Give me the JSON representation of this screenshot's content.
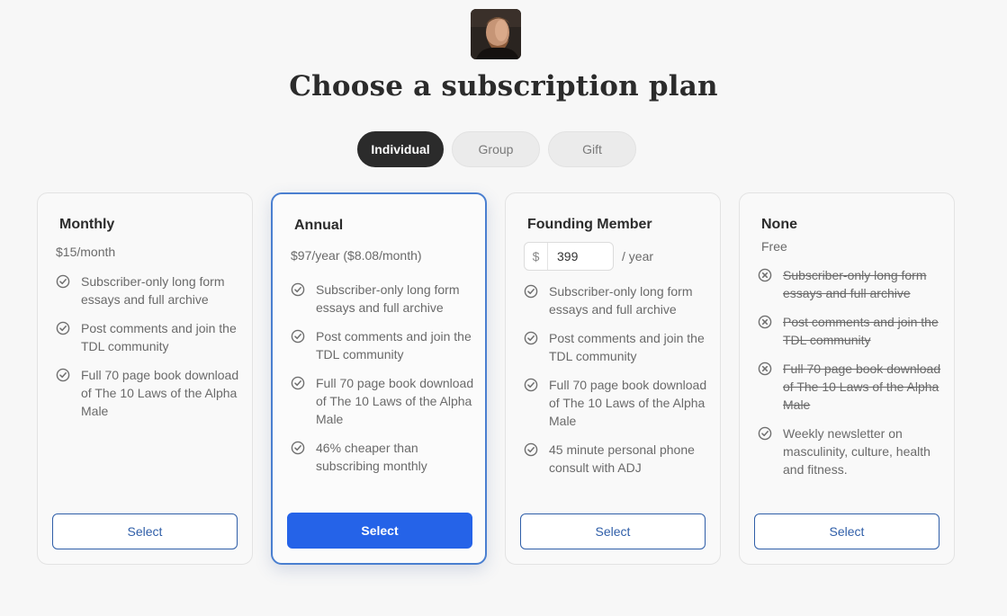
{
  "title": "Choose a subscription plan",
  "tabs": [
    {
      "label": "Individual"
    },
    {
      "label": "Group"
    },
    {
      "label": "Gift"
    }
  ],
  "plans": [
    {
      "name": "Monthly",
      "price": "$15/month",
      "features": [
        {
          "text": "Subscriber-only long form essays and full archive",
          "included": true
        },
        {
          "text": "Post comments and join the TDL community",
          "included": true
        },
        {
          "text": "Full 70 page book download of The 10 Laws of the Alpha Male",
          "included": true
        }
      ],
      "select_label": "Select"
    },
    {
      "name": "Annual",
      "price": "$97/year ($8.08/month)",
      "features": [
        {
          "text": "Subscriber-only long form essays and full archive",
          "included": true
        },
        {
          "text": "Post comments and join the TDL community",
          "included": true
        },
        {
          "text": "Full 70 page book download of The 10 Laws of the Alpha Male",
          "included": true
        },
        {
          "text": "46% cheaper than subscribing monthly",
          "included": true
        }
      ],
      "select_label": "Select"
    },
    {
      "name": "Founding Member",
      "currency": "$",
      "amount": "399",
      "per": "/ year",
      "features": [
        {
          "text": "Subscriber-only long form essays and full archive",
          "included": true
        },
        {
          "text": "Post comments and join the TDL community",
          "included": true
        },
        {
          "text": "Full 70 page book download of The 10 Laws of the Alpha Male",
          "included": true
        },
        {
          "text": "45 minute personal phone consult with ADJ",
          "included": true
        }
      ],
      "select_label": "Select"
    },
    {
      "name": "None",
      "price": "Free",
      "features": [
        {
          "text": "Subscriber-only long form essays and full archive",
          "included": false
        },
        {
          "text": "Post comments and join the TDL community",
          "included": false
        },
        {
          "text": "Full 70 page book download of The 10 Laws of the Alpha Male",
          "included": false
        },
        {
          "text": "Weekly newsletter on masculinity, culture, health and fitness.",
          "included": true
        }
      ],
      "select_label": "Select"
    }
  ],
  "icons": {
    "included": "check-circle-icon",
    "excluded": "x-circle-icon"
  },
  "colors": {
    "accent": "#2563e8",
    "featured_border": "#4a7fd0",
    "outline_button": "#2f5ea8",
    "tab_active": "#2b2b2b"
  }
}
